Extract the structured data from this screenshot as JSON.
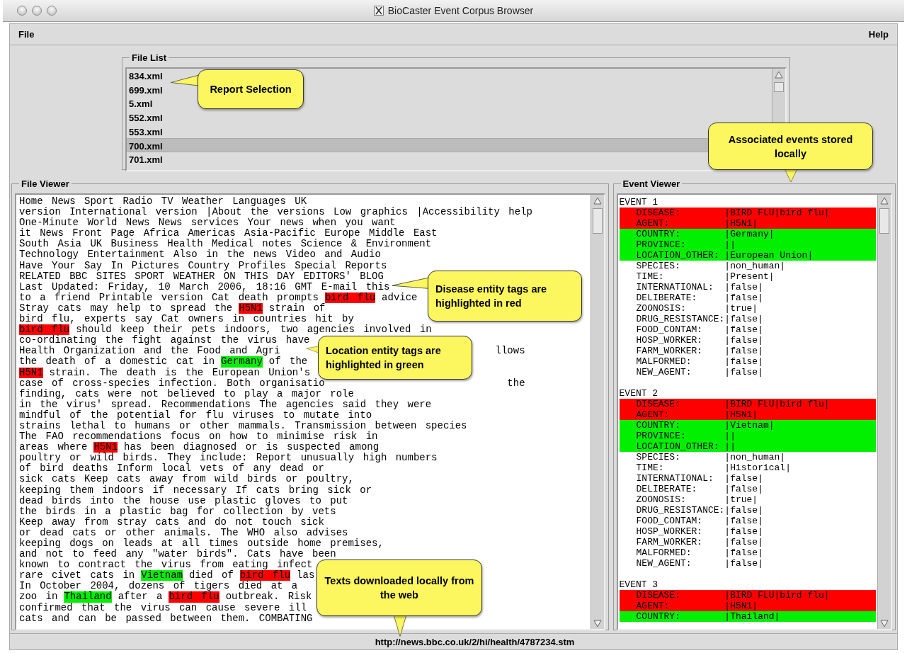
{
  "window": {
    "title": "BioCaster Event Corpus Browser"
  },
  "menu": {
    "left": "File",
    "right": "Help"
  },
  "file_list": {
    "title": "File List",
    "items": [
      {
        "label": "834.xml",
        "selected": false
      },
      {
        "label": "699.xml",
        "selected": false
      },
      {
        "label": "5.xml",
        "selected": false
      },
      {
        "label": "552.xml",
        "selected": false
      },
      {
        "label": "553.xml",
        "selected": false
      },
      {
        "label": "700.xml",
        "selected": true
      },
      {
        "label": "701.xml",
        "selected": false
      }
    ]
  },
  "file_viewer": {
    "title": "File Viewer",
    "lines": [
      [
        {
          "kind": "text",
          "text": "Home News Sport Radio TV Weather Languages UK"
        }
      ],
      [
        {
          "kind": "text",
          "text": "version International version |About the versions Low graphics |Accessibility help"
        }
      ],
      [
        {
          "kind": "text",
          "text": "One-Minute World News News services Your news when you want"
        }
      ],
      [
        {
          "kind": "text",
          "text": "it News Front Page Africa Americas Asia-Pacific Europe Middle East"
        }
      ],
      [
        {
          "kind": "text",
          "text": "South Asia UK Business Health Medical notes Science & Environment"
        }
      ],
      [
        {
          "kind": "text",
          "text": "Technology Entertainment Also in the news Video and Audio"
        }
      ],
      [
        {
          "kind": "text",
          "text": "Have Your Say In Pictures Country Profiles Special Reports"
        }
      ],
      [
        {
          "kind": "text",
          "text": "RELATED BBC SITES SPORT WEATHER ON THIS DAY EDITORS' BLOG"
        }
      ],
      [
        {
          "kind": "text",
          "text": "Last Updated: Friday, 10 March 2006, 18:16 GMT E-mail this"
        }
      ],
      [
        {
          "kind": "text",
          "text": "to a friend Printable version Cat death prompts"
        },
        {
          "kind": "disease",
          "text": "bird flu"
        },
        {
          "kind": "text",
          "text": "advice"
        }
      ],
      [
        {
          "kind": "text",
          "text": "Stray cats may help to spread the"
        },
        {
          "kind": "disease",
          "text": "H5N1"
        },
        {
          "kind": "text",
          "text": "strain of"
        }
      ],
      [
        {
          "kind": "text",
          "text": "bird flu, experts say Cat owners in countries hit by"
        }
      ],
      [
        {
          "kind": "disease",
          "text": "bird flu"
        },
        {
          "kind": "text",
          "text": "should keep their pets indoors, two agencies involved in"
        }
      ],
      [
        {
          "kind": "text",
          "text": "co-ordinating the fight against the virus have"
        }
      ],
      [
        {
          "kind": "text",
          "text": "Health Organization and the Food and Agri"
        },
        {
          "kind": "resume",
          "text": "llows"
        }
      ],
      [
        {
          "kind": "text",
          "text": "the death of a domestic cat in"
        },
        {
          "kind": "location",
          "text": "Germany"
        },
        {
          "kind": "text",
          "text": "of the"
        }
      ],
      [
        {
          "kind": "disease",
          "text": "H5N1"
        },
        {
          "kind": "text",
          "text": "strain. The death is the European Union's"
        }
      ],
      [
        {
          "kind": "text",
          "text": "case of cross-species infection. Both organisatio"
        },
        {
          "kind": "resume",
          "text": "the"
        }
      ],
      [
        {
          "kind": "text",
          "text": "finding, cats were not believed to play a major role"
        }
      ],
      [
        {
          "kind": "text",
          "text": "in the virus' spread. Recommendations The agencies said they were"
        }
      ],
      [
        {
          "kind": "text",
          "text": "mindful of the potential for flu viruses to mutate into"
        }
      ],
      [
        {
          "kind": "text",
          "text": "strains lethal to humans or other mammals. Transmission between species"
        }
      ],
      [
        {
          "kind": "text",
          "text": "The FAO recommendations focus on how to minimise risk in"
        }
      ],
      [
        {
          "kind": "text",
          "text": "areas where"
        },
        {
          "kind": "disease",
          "text": "H5N1"
        },
        {
          "kind": "text",
          "text": "has been diagnosed or is suspected among"
        }
      ],
      [
        {
          "kind": "text",
          "text": "poultry or wild birds. They include: Report unusually high numbers"
        }
      ],
      [
        {
          "kind": "text",
          "text": "of bird deaths Inform local vets of any dead or"
        }
      ],
      [
        {
          "kind": "text",
          "text": "sick cats Keep cats away from wild birds or poultry,"
        }
      ],
      [
        {
          "kind": "text",
          "text": "keeping them indoors if necessary If cats bring sick or"
        }
      ],
      [
        {
          "kind": "text",
          "text": "dead birds into the house use plastic gloves to put"
        }
      ],
      [
        {
          "kind": "text",
          "text": "the birds in a plastic bag for collection by vets"
        }
      ],
      [
        {
          "kind": "text",
          "text": "Keep away from stray cats and do not touch sick"
        }
      ],
      [
        {
          "kind": "text",
          "text": "or dead cats or other animals. The WHO also advises"
        }
      ],
      [
        {
          "kind": "text",
          "text": "keeping dogs on leads at all times outside home premises,"
        }
      ],
      [
        {
          "kind": "text",
          "text": "and not to feed any \"water birds\". Cats have been"
        }
      ],
      [
        {
          "kind": "text",
          "text": "known to contract the virus from eating infect"
        }
      ],
      [
        {
          "kind": "text",
          "text": "rare civet cats in"
        },
        {
          "kind": "location",
          "text": "Vietnam"
        },
        {
          "kind": "text",
          "text": "died of"
        },
        {
          "kind": "disease",
          "text": "bird flu"
        },
        {
          "kind": "text",
          "text": "las"
        }
      ],
      [
        {
          "kind": "text",
          "text": "In October 2004, dozens of tigers died at a"
        }
      ],
      [
        {
          "kind": "text",
          "text": "zoo in"
        },
        {
          "kind": "location",
          "text": "Thailand"
        },
        {
          "kind": "text",
          "text": "after a"
        },
        {
          "kind": "disease",
          "text": "bird flu"
        },
        {
          "kind": "text",
          "text": "outbreak. Risk"
        }
      ],
      [
        {
          "kind": "text",
          "text": "confirmed that the virus can cause severe ill"
        }
      ],
      [
        {
          "kind": "text",
          "text": "cats and can be passed between them. COMBATING"
        }
      ]
    ]
  },
  "event_viewer": {
    "title": "Event Viewer",
    "events": [
      {
        "header": "EVENT 1",
        "groups": [
          {
            "kind": "disease",
            "fields": [
              {
                "label": "DISEASE:",
                "value": "|BIRD FLU|bird flu|"
              },
              {
                "label": "AGENT:",
                "value": "|H5N1|"
              }
            ]
          },
          {
            "kind": "location",
            "fields": [
              {
                "label": "COUNTRY:",
                "value": "|Germany|"
              },
              {
                "label": "PROVINCE:",
                "value": "||"
              },
              {
                "label": "LOCATION_OTHER:",
                "value": "|European Union|"
              }
            ]
          },
          {
            "kind": "plain",
            "fields": [
              {
                "label": "SPECIES:",
                "value": "|non_human|"
              },
              {
                "label": "TIME:",
                "value": "|Present|"
              },
              {
                "label": "INTERNATIONAL:",
                "value": "|false|"
              },
              {
                "label": "DELIBERATE:",
                "value": "|false|"
              },
              {
                "label": "ZOONOSIS:",
                "value": "|true|"
              },
              {
                "label": "DRUG_RESISTANCE:",
                "value": "|false|"
              },
              {
                "label": "FOOD_CONTAM:",
                "value": "|false|"
              },
              {
                "label": "HOSP_WORKER:",
                "value": "|false|"
              },
              {
                "label": "FARM_WORKER:",
                "value": "|false|"
              },
              {
                "label": "MALFORMED:",
                "value": "|false|"
              },
              {
                "label": "NEW_AGENT:",
                "value": "|false|"
              }
            ]
          }
        ]
      },
      {
        "header": "EVENT 2",
        "groups": [
          {
            "kind": "disease",
            "fields": [
              {
                "label": "DISEASE:",
                "value": "|BIRD FLU|bird flu|"
              },
              {
                "label": "AGENT:",
                "value": "|H5N1|"
              }
            ]
          },
          {
            "kind": "location",
            "fields": [
              {
                "label": "COUNTRY:",
                "value": "|Vietnam|"
              },
              {
                "label": "PROVINCE:",
                "value": "||"
              },
              {
                "label": "LOCATION_OTHER:",
                "value": "||"
              }
            ]
          },
          {
            "kind": "plain",
            "fields": [
              {
                "label": "SPECIES:",
                "value": "|non_human|"
              },
              {
                "label": "TIME:",
                "value": "|Historical|"
              },
              {
                "label": "INTERNATIONAL:",
                "value": "|false|"
              },
              {
                "label": "DELIBERATE:",
                "value": "|false|"
              },
              {
                "label": "ZOONOSIS:",
                "value": "|true|"
              },
              {
                "label": "DRUG_RESISTANCE:",
                "value": "|false|"
              },
              {
                "label": "FOOD_CONTAM:",
                "value": "|false|"
              },
              {
                "label": "HOSP_WORKER:",
                "value": "|false|"
              },
              {
                "label": "FARM_WORKER:",
                "value": "|false|"
              },
              {
                "label": "MALFORMED:",
                "value": "|false|"
              },
              {
                "label": "NEW_AGENT:",
                "value": "|false|"
              }
            ]
          }
        ]
      },
      {
        "header": "EVENT 3",
        "groups": [
          {
            "kind": "disease",
            "fields": [
              {
                "label": "DISEASE:",
                "value": "|BIRD FLU|bird flu|"
              },
              {
                "label": "AGENT:",
                "value": "|H5N1|"
              }
            ]
          },
          {
            "kind": "location",
            "fields": [
              {
                "label": "COUNTRY:",
                "value": "|Thailand|"
              }
            ]
          }
        ]
      }
    ]
  },
  "status_bar": {
    "url": "http://news.bbc.co.uk/2/hi/health/4787234.stm"
  },
  "callouts": [
    {
      "text": "Report Selection"
    },
    {
      "text": "Associated events stored locally"
    },
    {
      "text": "Disease entity tags are highlighted in red"
    },
    {
      "text": "Location entity tags are highlighted in green"
    },
    {
      "text": "Texts downloaded locally from the web"
    }
  ]
}
